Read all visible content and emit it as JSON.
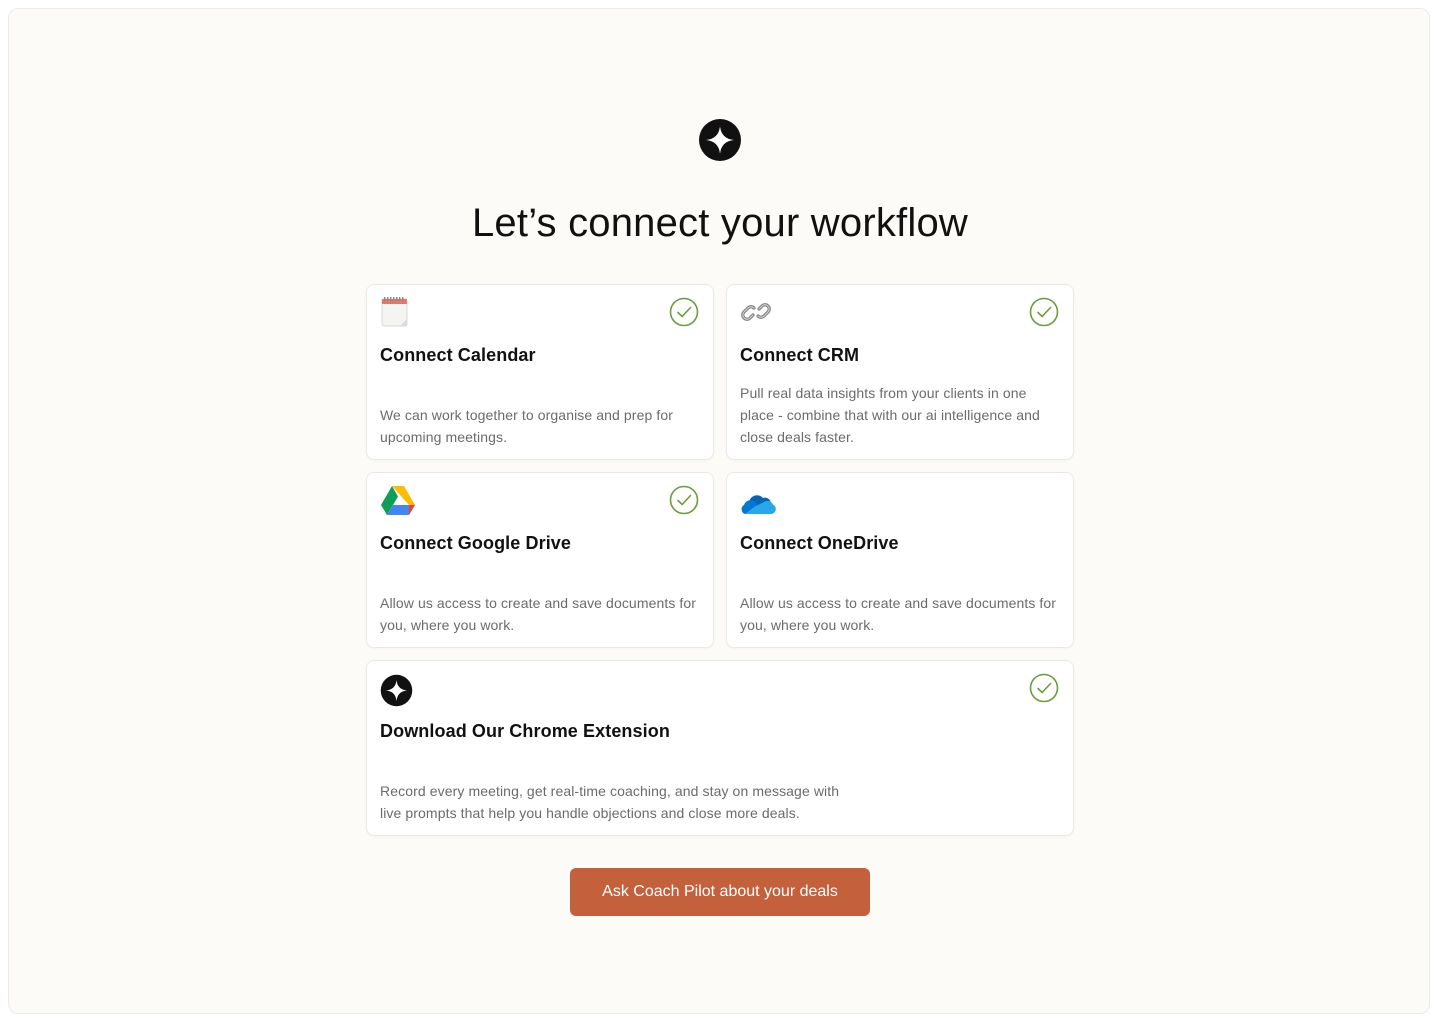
{
  "page": {
    "title": "Let’s connect your workflow",
    "logo_icon": "sparkle-logo-icon"
  },
  "cards": [
    {
      "title": "Connect Calendar",
      "description": "We can work together to organise and prep for upcoming meetings.",
      "icon": "calendar-icon",
      "connected": true
    },
    {
      "title": "Connect CRM",
      "description": "Pull real data insights from your clients in one place - combine that with our ai intelligence and close deals faster.",
      "icon": "link-icon",
      "connected": true
    },
    {
      "title": "Connect Google Drive",
      "description": "Allow us access to create and save documents for you, where you work.",
      "icon": "google-drive-icon",
      "connected": true
    },
    {
      "title": "Connect OneDrive",
      "description": "Allow us access to create and save documents for you, where you work.",
      "icon": "onedrive-icon",
      "connected": false
    },
    {
      "title": "Download Our Chrome Extension",
      "description": "Record every meeting, get real-time coaching, and stay on message with live prompts that help you handle objections and close more deals.",
      "icon": "sparkle-logo-icon",
      "connected": true
    }
  ],
  "cta": {
    "label": "Ask Coach Pilot about your deals"
  },
  "colors": {
    "accent": "#c4603b",
    "check": "#6e9a3a",
    "background": "#fcfbf8"
  }
}
